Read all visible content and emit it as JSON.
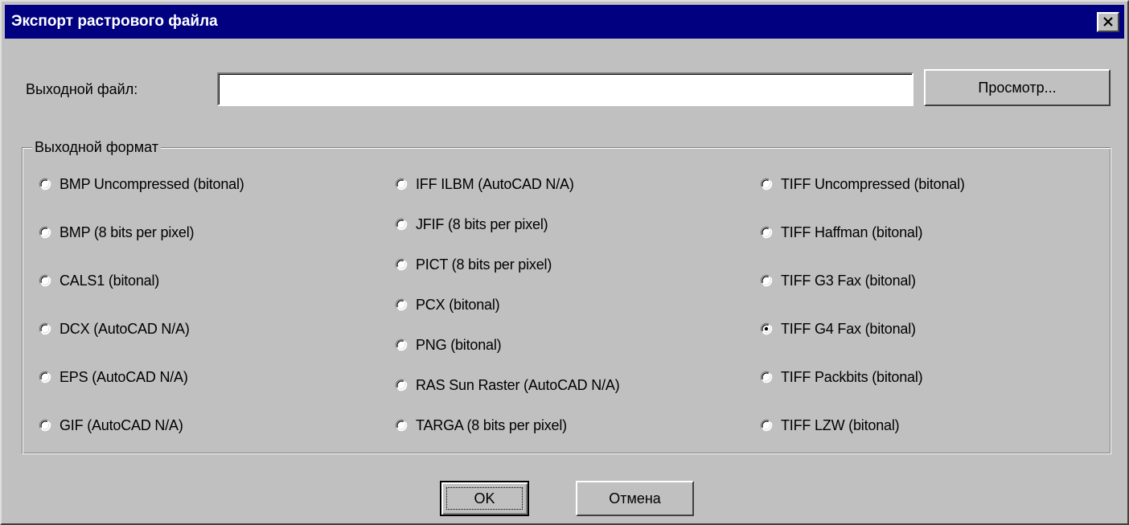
{
  "window": {
    "title": "Экспорт растрового файла"
  },
  "output_file": {
    "label": "Выходной файл:",
    "value": "",
    "browse_label": "Просмотр..."
  },
  "format_group": {
    "title": "Выходной формат",
    "columns": [
      [
        {
          "label": "BMP Uncompressed  (bitonal)",
          "checked": false
        },
        {
          "label": "BMP (8 bits per pixel)",
          "checked": false
        },
        {
          "label": "CALS1  (bitonal)",
          "checked": false
        },
        {
          "label": "DCX  (AutoCAD N/A)",
          "checked": false
        },
        {
          "label": "EPS  (AutoCAD N/A)",
          "checked": false
        },
        {
          "label": "GIF   (AutoCAD N/A)",
          "checked": false
        }
      ],
      [
        {
          "label": "IFF ILBM  (AutoCAD N/A)",
          "checked": false
        },
        {
          "label": "JFIF   (8 bits per pixel)",
          "checked": false
        },
        {
          "label": "PICT  (8 bits per pixel)",
          "checked": false
        },
        {
          "label": "PCX   (bitonal)",
          "checked": false
        },
        {
          "label": "PNG  (bitonal)",
          "checked": false
        },
        {
          "label": "RAS Sun Raster  (AutoCAD N/A)",
          "checked": false
        },
        {
          "label": "TARGA  (8 bits per pixel)",
          "checked": false
        }
      ],
      [
        {
          "label": "TIFF Uncompressed (bitonal)",
          "checked": false
        },
        {
          "label": "TIFF Haffman  (bitonal)",
          "checked": false
        },
        {
          "label": "TIFF G3 Fax  (bitonal)",
          "checked": false
        },
        {
          "label": "TIFF G4 Fax  (bitonal)",
          "checked": true
        },
        {
          "label": "TIFF Packbits  (bitonal)",
          "checked": false
        },
        {
          "label": "TIFF LZW  (bitonal)",
          "checked": false
        }
      ]
    ]
  },
  "buttons": {
    "ok_label": "OK",
    "cancel_label": "Отмена"
  }
}
